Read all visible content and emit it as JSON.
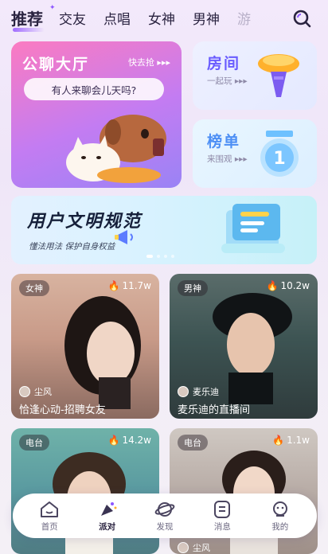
{
  "top_tabs": [
    {
      "label": "推荐",
      "active": true
    },
    {
      "label": "交友",
      "active": false
    },
    {
      "label": "点唱",
      "active": false
    },
    {
      "label": "女神",
      "active": false
    },
    {
      "label": "男神",
      "active": false
    },
    {
      "label": "游",
      "active": false
    }
  ],
  "cards": {
    "chat": {
      "title": "公聊大厅",
      "grab": "快去抢",
      "bubble": "有人来聊会儿天吗?"
    },
    "room": {
      "title": "房间",
      "sub": "一起玩"
    },
    "rank": {
      "title": "榜单",
      "sub": "来围观"
    }
  },
  "banner": {
    "headline": "用户文明规范",
    "subline": "懂法用法 保护自身权益"
  },
  "streams": [
    {
      "tag": "女神",
      "viewers": "11.7w",
      "host": "尘风",
      "title": "恰逢心动-招聘女友"
    },
    {
      "tag": "男神",
      "viewers": "10.2w",
      "host": "麦乐迪",
      "title": "麦乐迪的直播间"
    },
    {
      "tag": "电台",
      "viewers": "14.2w",
      "host": "",
      "title": ""
    },
    {
      "tag": "电台",
      "viewers": "1.1w",
      "host": "尘风",
      "title": ""
    }
  ],
  "bottom_nav": [
    {
      "label": "首页",
      "icon": "home-icon",
      "active": false
    },
    {
      "label": "派对",
      "icon": "party-icon",
      "active": true
    },
    {
      "label": "发现",
      "icon": "planet-icon",
      "active": false
    },
    {
      "label": "消息",
      "icon": "message-icon",
      "active": false
    },
    {
      "label": "我的",
      "icon": "profile-icon",
      "active": false
    }
  ],
  "colors": {
    "accent": "#8d57ff",
    "room_title": "#6a5cff",
    "rank_title": "#4d8ff5"
  }
}
